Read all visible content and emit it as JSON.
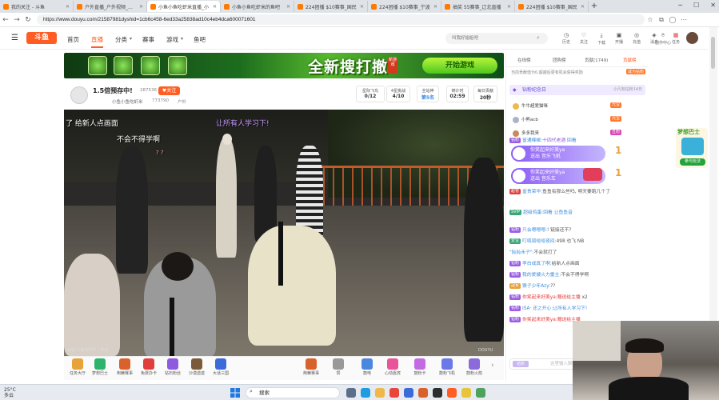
{
  "browser": {
    "tabs": [
      {
        "title": "我的关注 - 斗鱼",
        "active": false
      },
      {
        "title": "户外直播_户外视频_斗鱼直播",
        "active": false
      },
      {
        "title": "小鱼小鱼吃虾米直播_小",
        "active": true
      },
      {
        "title": "小鱼小鱼吃虾米的鱼吧",
        "active": false
      },
      {
        "title": "224团播 $10赛事_国民",
        "active": false
      },
      {
        "title": "224团播 $10赛事_宁波",
        "active": false
      },
      {
        "title": "抽奖 55赛事_辽北直播",
        "active": false
      },
      {
        "title": "224团播 $10赛事_国民",
        "active": false
      }
    ],
    "url": "https://www.douyu.com/21587981dyshid=1cb6c458-6ed33a25838ad10c4eb4dca600071601"
  },
  "header": {
    "logo": "斗鱼",
    "nav": [
      "首页",
      "直播",
      "分类",
      "赛事",
      "游戏",
      "鱼吧"
    ],
    "active_nav": "直播",
    "search_placeholder": "叫我好姐姐吧",
    "icons": [
      {
        "name": "history",
        "label": "历史"
      },
      {
        "name": "follow",
        "label": "关注"
      },
      {
        "name": "download",
        "label": "下载"
      },
      {
        "name": "live",
        "label": "开播"
      },
      {
        "name": "recharge",
        "label": "充值"
      },
      {
        "name": "message",
        "label": "消息"
      },
      {
        "name": "center",
        "label": "创作中心"
      },
      {
        "name": "task",
        "label": "任务"
      }
    ]
  },
  "banner": {
    "title": "全新搜打撤",
    "subtitle": "新游戏",
    "button": "开始游戏"
  },
  "room": {
    "title": "1.5倍预存中!",
    "hot": "287536",
    "follow": "关注",
    "anchor": "小鱼小鱼吃虾米",
    "fans": "773790",
    "category": "户外",
    "boxes": [
      {
        "label": "星际飞鸟",
        "value": "0/12"
      },
      {
        "label": "4星挑战",
        "value": "4/10"
      },
      {
        "label": "全站神",
        "value": "第5名"
      },
      {
        "label": "倒计时",
        "value": "02:59"
      },
      {
        "label": "每日贡献",
        "value": "20秒"
      }
    ]
  },
  "video": {
    "overlay_texts": [
      "了  给新人点画面",
      "不会不得学啊",
      "让所有人学习下!"
    ],
    "watermark": "DOUYU",
    "uid": "房管:小鱼的同学 | 昨天"
  },
  "gifts": [
    {
      "label": "任务大厅",
      "color": "#e8a23a"
    },
    {
      "label": "梦想巴士",
      "color": "#2db36a"
    },
    {
      "label": "荆棘赛事",
      "color": "#d9622c"
    },
    {
      "label": "免费办卡",
      "color": "#e23d3d"
    },
    {
      "label": "钻石粉丝",
      "color": "#8f5ae0"
    },
    {
      "label": "沙漠遗迹",
      "color": "#7a5a3a"
    },
    {
      "label": "大话三国",
      "color": "#3a6bd9"
    },
    {
      "label": "荆棘赛事",
      "color": "#d9622c"
    },
    {
      "label": "赞",
      "color": "#999999"
    },
    {
      "label": "鼓电",
      "color": "#4a88e0"
    },
    {
      "label": "心动嘉宾",
      "color": "#e8539a"
    },
    {
      "label": "鼓粉卡",
      "color": "#c36be0"
    },
    {
      "label": "鼓粉飞机",
      "color": "#6a78e8"
    },
    {
      "label": "鼓粉火箭",
      "color": "#8b6bd9"
    }
  ],
  "sidebar": {
    "tabs": [
      "在线榜",
      "团购榜",
      "贡献(1749)",
      "贡献榜"
    ],
    "active_tab": "贡献榜",
    "rank_tip": "当前贡献值为0,超越后更有机会获得奖励",
    "diamond_title": "钻粉纪念日",
    "diamond_right": "小凡有钻粉14日",
    "ranks": [
      {
        "name": "牛牛超爱猫咪",
        "badge": "元宝",
        "badge_color": "#ff7a2e"
      },
      {
        "name": "小熊acb",
        "badge": "元宝",
        "badge_color": "#ff7a2e"
      },
      {
        "name": "多多我来",
        "badge": "五粉",
        "badge_color": "#d94ab0"
      }
    ],
    "chats": [
      {
        "badge": "钻粉",
        "badge_color": "#9b5de5",
        "name": "富通辣椒:",
        "text": "十四代老酒",
        "extra": "回看"
      },
      {
        "badge": "超管",
        "badge_color": "#e23d3d",
        "name": "富贵荣华:",
        "text": "鱼鱼有那么些吗",
        "extra": "明天要跑几个了"
      },
      {
        "badge": "SVIP",
        "badge_color": "#3aa67a",
        "name": "超级鸡蛋:",
        "text": "回看",
        "extra": "让鱼鱼音"
      },
      {
        "badge": "钻粉",
        "badge_color": "#9b5de5",
        "name": "只会嗯嗯嗯:",
        "text": "!  链接还不?",
        "extra": ""
      },
      {
        "badge": "爱宝",
        "badge_color": "#3aa67a",
        "name": "叮呱呱哈哈夜间:",
        "text": "498 也飞  NB",
        "extra": ""
      },
      {
        "badge": "",
        "badge_color": "#999999",
        "name": "\"鈊鈊禾子\":",
        "text": "不会就打了",
        "extra": ""
      },
      {
        "badge": "钻粉",
        "badge_color": "#9b5de5",
        "name": "李白成真了啊:",
        "text": "给新人点画面",
        "extra": ""
      },
      {
        "badge": "钻粉",
        "badge_color": "#9b5de5",
        "name": "我的爱嫂火力雷主:",
        "text": "不会不得学啊",
        "extra": ""
      },
      {
        "badge": "冠军",
        "badge_color": "#e8a23a",
        "name": "猴子少年Azy:",
        "text": "??",
        "extra": ""
      },
      {
        "badge": "钻粉",
        "badge_color": "#9b5de5",
        "name": "你笑起来好美ya:",
        "text": "赠送给主播",
        "extra": "x2"
      },
      {
        "badge": "钻粉",
        "badge_color": "#9b5de5",
        "name": "ISA· 还之开心:",
        "text": "让所有人学习下!",
        "extra": ""
      },
      {
        "badge": "钻粉",
        "badge_color": "#9b5de5",
        "name": "你笑起来好美ya:",
        "text": "赠送给主播",
        "extra": ""
      }
    ],
    "gift_cards": [
      {
        "name": "你笑起来好美ya",
        "text": "送出 音乐飞机",
        "count": "1"
      },
      {
        "name": "你笑起来好美ya",
        "text": "送出 音乐车",
        "count": "1"
      }
    ],
    "input_placeholder": "这里输入聊天内容",
    "input_tag": "钻粉"
  },
  "right_ad": {
    "title": "梦想巴士",
    "button": "参与玩法"
  },
  "taskbar": {
    "temp": "25°C",
    "weather": "多云",
    "search": "搜索"
  }
}
